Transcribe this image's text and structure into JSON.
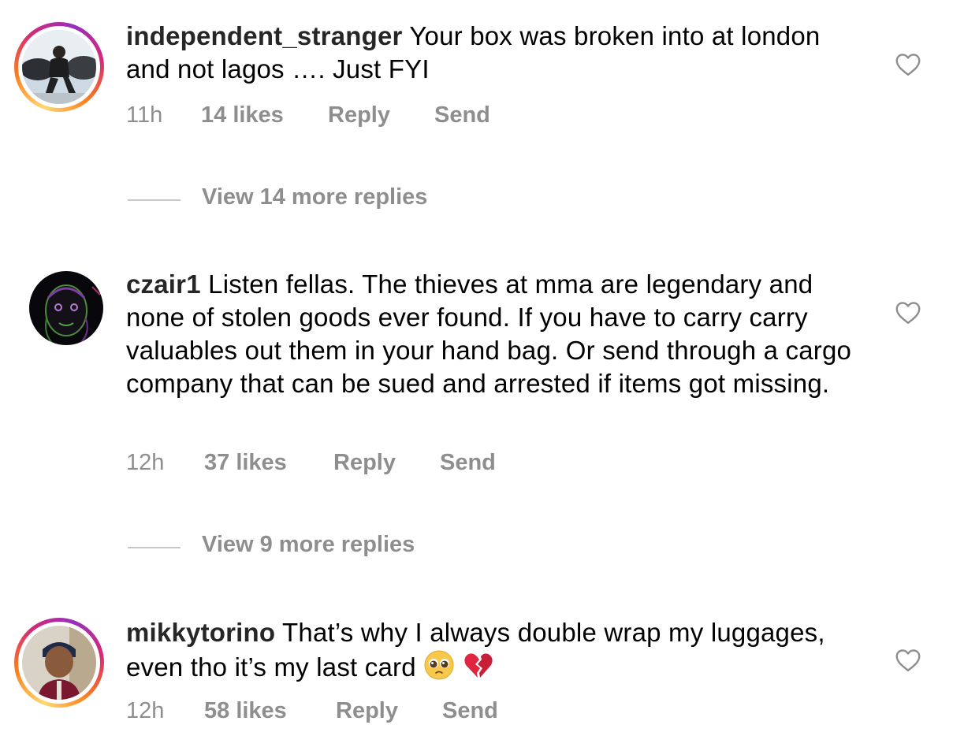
{
  "comments": [
    {
      "username": "independent_stranger",
      "text": "Your box was broken into at london and not lagos …. Just FYI",
      "time": "11h",
      "likes": "14 likes",
      "reply": "Reply",
      "send": "Send",
      "view_more": "View 14 more replies",
      "has_story_ring": true
    },
    {
      "username": "czair1",
      "text": "Listen fellas. The thieves at mma are legendary and none of stolen goods ever found. If you have to carry carry valuables out them in your hand bag. Or send through a cargo company that can be sued and arrested if items got missing.",
      "time": "12h",
      "likes": "37 likes",
      "reply": "Reply",
      "send": "Send",
      "view_more": "View 9 more replies",
      "has_story_ring": false
    },
    {
      "username": "mikkytorino",
      "text": "That’s why I always double wrap my luggages, even tho it’s my last card",
      "emojis": [
        "pleading-face",
        "broken-heart"
      ],
      "time": "12h",
      "likes": "58 likes",
      "reply": "Reply",
      "send": "Send",
      "has_story_ring": true
    }
  ],
  "colors": {
    "meta_text": "#8e8e8e",
    "username": "#262626",
    "divider": "#c7c7c7"
  }
}
